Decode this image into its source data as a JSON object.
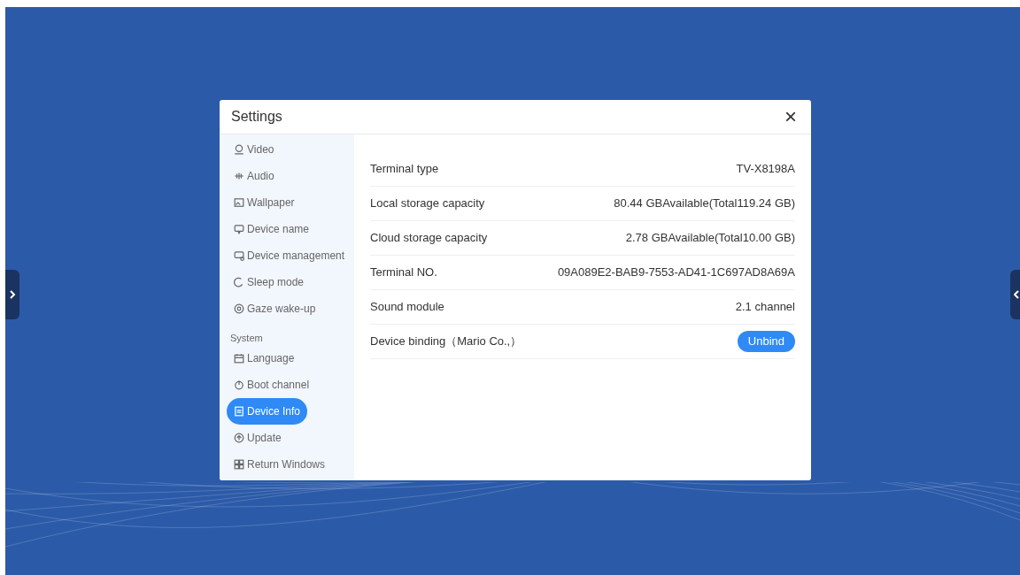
{
  "dialog": {
    "title": "Settings",
    "close": "×"
  },
  "sidebar": {
    "groups": [
      {
        "items": [
          {
            "label": "Video",
            "selected": false
          },
          {
            "label": "Audio",
            "selected": false
          },
          {
            "label": "Wallpaper",
            "selected": false
          },
          {
            "label": "Device name",
            "selected": false
          },
          {
            "label": "Device management",
            "selected": false
          },
          {
            "label": "Sleep mode",
            "selected": false
          },
          {
            "label": "Gaze wake-up",
            "selected": false
          }
        ]
      },
      {
        "title": "System",
        "items": [
          {
            "label": "Language",
            "selected": false
          },
          {
            "label": "Boot channel",
            "selected": false
          },
          {
            "label": "Device Info",
            "selected": true
          },
          {
            "label": "Update",
            "selected": false
          },
          {
            "label": "Return Windows",
            "selected": false
          }
        ]
      }
    ]
  },
  "rows": [
    {
      "kind": "text",
      "label": "Terminal type",
      "value": "TV-X8198A"
    },
    {
      "kind": "text",
      "label": "Local storage capacity",
      "value": "80.44 GBAvailable(Total119.24 GB)"
    },
    {
      "kind": "text",
      "label": "Cloud storage capacity",
      "value": "2.78 GBAvailable(Total10.00 GB)"
    },
    {
      "kind": "text",
      "label": "Terminal NO.",
      "value": "09A089E2-BAB9-7553-AD41-1C697AD8A69A"
    },
    {
      "kind": "text",
      "label": "Sound module",
      "value": "2.1 channel"
    },
    {
      "kind": "button",
      "label": "Device binding（Mario Co.,）",
      "value": "Unbind"
    }
  ]
}
